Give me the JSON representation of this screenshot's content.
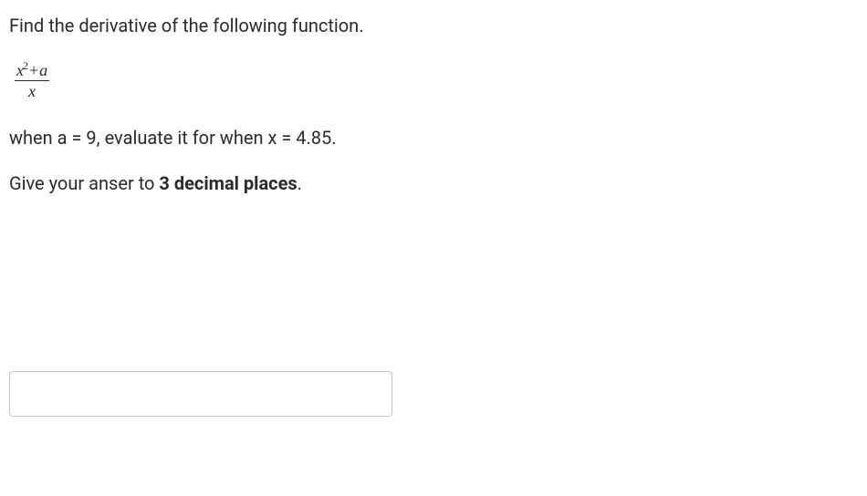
{
  "question": {
    "prompt": "Find the derivative of the following function.",
    "formula": {
      "numerator_x": "x",
      "numerator_exp": "2",
      "numerator_plus": "+",
      "numerator_a": "a",
      "denominator": "x"
    },
    "condition": "when a = 9, evaluate it for when x = 4.85.",
    "instruction_prefix": "Give your anser to ",
    "instruction_bold": "3 decimal places",
    "instruction_suffix": "."
  },
  "answer": {
    "value": "",
    "placeholder": ""
  }
}
